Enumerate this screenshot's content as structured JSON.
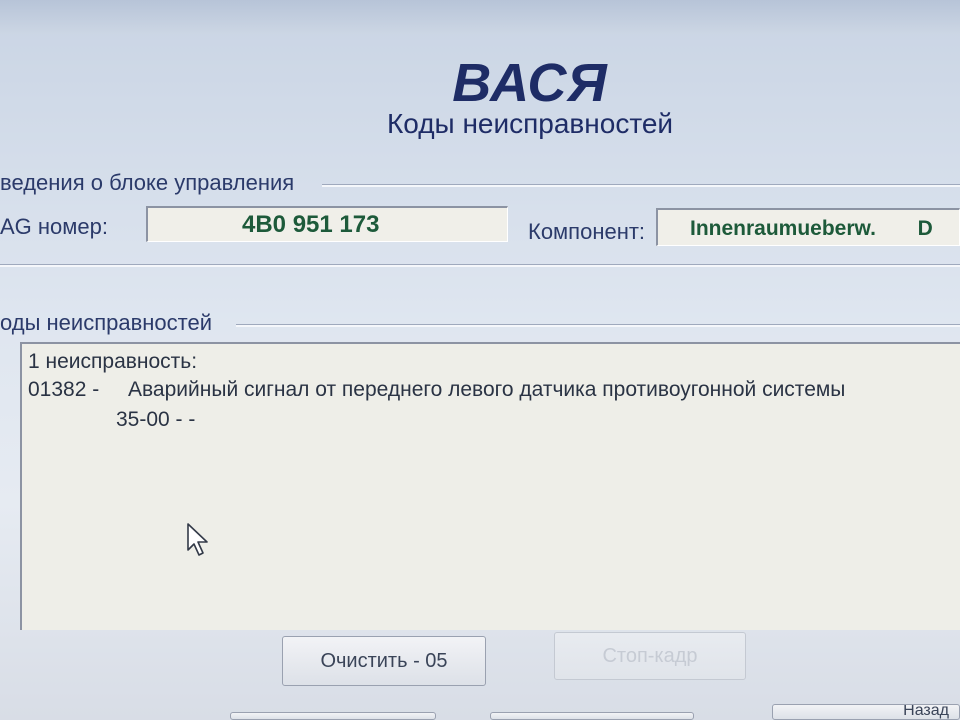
{
  "header": {
    "app_title": "ВАСЯ",
    "subtitle": "Коды неисправностей"
  },
  "control_unit": {
    "group_label": "ведения о блоке управления",
    "vag_label": "AG номер:",
    "vag_value": "4B0 951 173",
    "component_label": "Компонент:",
    "component_value": "Innenraumueberw.",
    "component_extra": "D"
  },
  "fault_codes": {
    "group_label": "оды неисправностей",
    "count_line": "1 неисправность:",
    "entries": [
      {
        "code": "01382 -",
        "description": "Аварийный сигнал от переднего левого датчика противоугонной системы",
        "detail": "35-00 -    -"
      }
    ]
  },
  "buttons": {
    "clear": "Очистить - 05",
    "freeze_frame": "Стоп-кадр",
    "back": "Назад"
  },
  "colors": {
    "title": "#1e2c66",
    "field_value": "#1d5a3a",
    "background": "#dfe6f0"
  }
}
